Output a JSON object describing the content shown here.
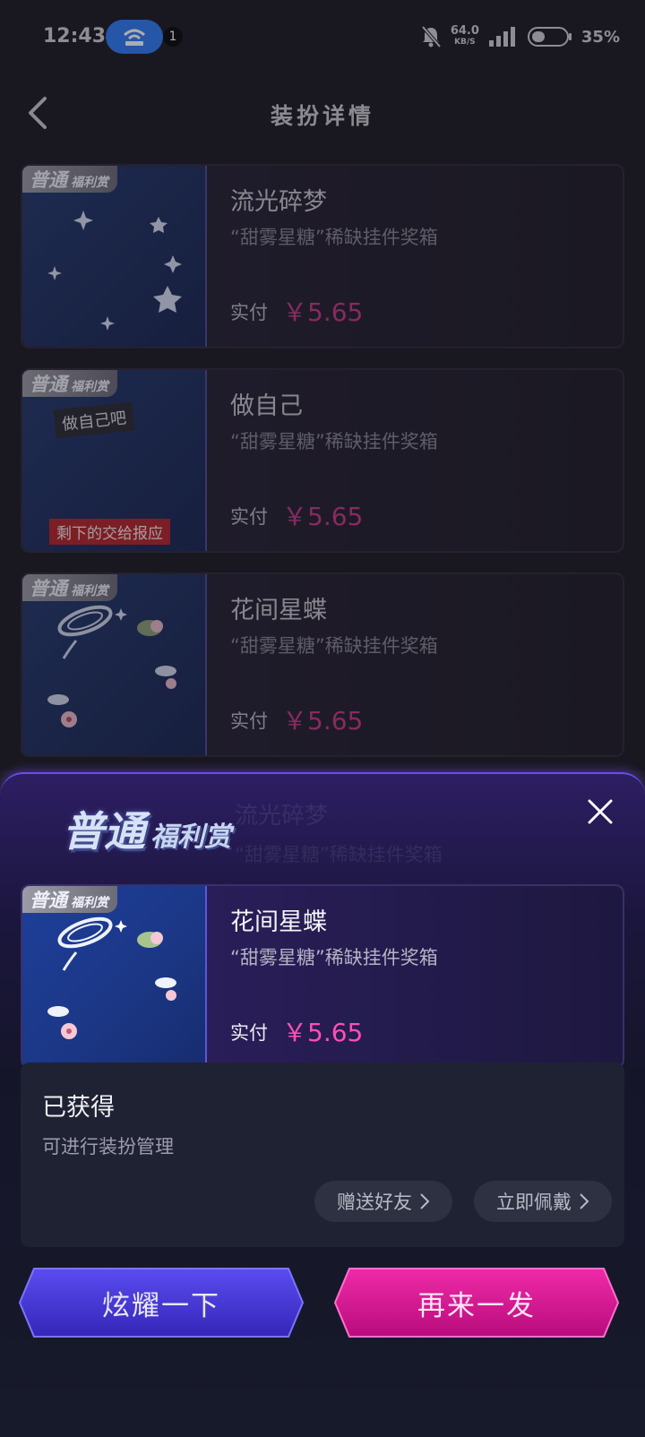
{
  "status_bar": {
    "time": "12:43",
    "notification_count": "1",
    "net_speed": "64.0",
    "net_unit": "KB/S",
    "battery": "35%"
  },
  "nav": {
    "title": "装扮详情"
  },
  "list": [
    {
      "badge_main": "普通",
      "badge_sub": "福利赏",
      "title": "流光碎梦",
      "subtitle": "“甜雾星糖”稀缺挂件奖箱",
      "pay_label": "实付",
      "price": "￥5.65"
    },
    {
      "badge_main": "普通",
      "badge_sub": "福利赏",
      "title": "做自己",
      "subtitle": "“甜雾星糖”稀缺挂件奖箱",
      "pay_label": "实付",
      "price": "￥5.65",
      "thumb_text_top": "做自己吧",
      "thumb_text_bottom": "剩下的交给报应"
    },
    {
      "badge_main": "普通",
      "badge_sub": "福利赏",
      "title": "花间星蝶",
      "subtitle": "“甜雾星糖”稀缺挂件奖箱",
      "pay_label": "实付",
      "price": "￥5.65"
    }
  ],
  "sheet": {
    "logo_main": "普通",
    "logo_sub": "福利赏",
    "ghost_title": "流光碎梦",
    "ghost_subtitle": "“甜雾星糖”稀缺挂件奖箱",
    "result": {
      "badge_main": "普通",
      "badge_sub": "福利赏",
      "title": "花间星蝶",
      "subtitle": "“甜雾星糖”稀缺挂件奖箱",
      "pay_label": "实付",
      "price": "￥5.65"
    },
    "status_title": "已获得",
    "status_desc": "可进行装扮管理",
    "gift_label": "赠送好友",
    "wear_label": "立即佩戴",
    "show_label": "炫耀一下",
    "again_label": "再来一发"
  },
  "colors": {
    "price": "#c33a86",
    "price_active": "#ff4fb5",
    "show_button": "#4a3bd8",
    "again_button": "#e0169a"
  }
}
